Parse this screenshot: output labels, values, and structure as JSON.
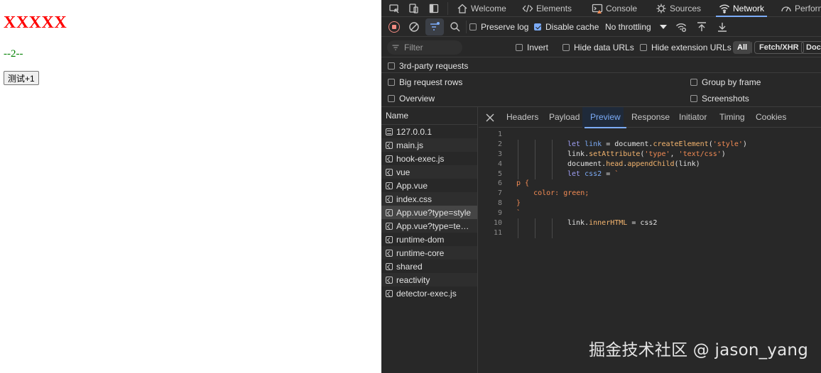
{
  "webpage": {
    "heading": "XXXXX",
    "counter": "--2--",
    "button_label": "测试+1",
    "heading_color": "#ff0000",
    "counter_color": "#008000"
  },
  "devtools": {
    "tabs": [
      {
        "label": "Welcome",
        "icon": "home-icon"
      },
      {
        "label": "Elements",
        "icon": "code-brackets-icon"
      },
      {
        "label": "Console",
        "icon": "console-warning-icon"
      },
      {
        "label": "Sources",
        "icon": "sources-icon"
      },
      {
        "label": "Network",
        "icon": "wifi-icon",
        "active": true
      },
      {
        "label": "Perform",
        "icon": "performance-icon"
      }
    ],
    "toolbar": {
      "preserve_log": "Preserve log",
      "preserve_log_checked": false,
      "disable_cache": "Disable cache",
      "disable_cache_checked": true,
      "throttling": "No throttling"
    },
    "filter": {
      "placeholder": "Filter",
      "invert": "Invert",
      "hide_data_urls": "Hide data URLs",
      "hide_extension_urls": "Hide extension URLs",
      "type_all": "All",
      "type_fetch": "Fetch/XHR",
      "type_doc": "Doc"
    },
    "third_party": "3rd-party requests",
    "settings": {
      "big_request_rows": "Big request rows",
      "overview": "Overview",
      "group_by_frame": "Group by frame",
      "screenshots": "Screenshots"
    },
    "request_list": {
      "header": "Name",
      "items": [
        {
          "name": "127.0.0.1",
          "type": "doc"
        },
        {
          "name": "main.js",
          "type": "code"
        },
        {
          "name": "hook-exec.js",
          "type": "code"
        },
        {
          "name": "vue",
          "type": "code"
        },
        {
          "name": "App.vue",
          "type": "code"
        },
        {
          "name": "index.css",
          "type": "code"
        },
        {
          "name": "App.vue?type=style",
          "type": "code",
          "selected": true
        },
        {
          "name": "App.vue?type=tem...",
          "type": "code"
        },
        {
          "name": "runtime-dom",
          "type": "code"
        },
        {
          "name": "runtime-core",
          "type": "code"
        },
        {
          "name": "shared",
          "type": "code"
        },
        {
          "name": "reactivity",
          "type": "code"
        },
        {
          "name": "detector-exec.js",
          "type": "code"
        }
      ]
    },
    "detail_tabs": [
      "Headers",
      "Payload",
      "Preview",
      "Response",
      "Initiator",
      "Timing",
      "Cookies"
    ],
    "detail_active": "Preview",
    "code_lines": [
      {
        "n": "1",
        "indent": 0,
        "tokens": []
      },
      {
        "n": "2",
        "indent": 3,
        "tokens": [
          [
            "kw",
            "let "
          ],
          [
            "def",
            "link"
          ],
          [
            "plain",
            " = document."
          ],
          [
            "fn",
            "createElement"
          ],
          [
            "plain",
            "("
          ],
          [
            "str",
            "'style'"
          ],
          [
            "plain",
            ")"
          ]
        ]
      },
      {
        "n": "3",
        "indent": 3,
        "tokens": [
          [
            "plain",
            "link."
          ],
          [
            "fn",
            "setAttribute"
          ],
          [
            "plain",
            "("
          ],
          [
            "str",
            "'type'"
          ],
          [
            "plain",
            ", "
          ],
          [
            "str",
            "'text/css'"
          ],
          [
            "plain",
            ")"
          ]
        ]
      },
      {
        "n": "4",
        "indent": 3,
        "tokens": [
          [
            "plain",
            "document."
          ],
          [
            "fn",
            "head"
          ],
          [
            "plain",
            "."
          ],
          [
            "fn",
            "appendChild"
          ],
          [
            "plain",
            "(link)"
          ]
        ]
      },
      {
        "n": "5",
        "indent": 3,
        "tokens": [
          [
            "kw",
            "let "
          ],
          [
            "def",
            "css2"
          ],
          [
            "plain",
            " = "
          ],
          [
            "str",
            "`"
          ]
        ]
      },
      {
        "n": "6",
        "indent": 0,
        "tokens": [
          [
            "sel",
            "p {"
          ]
        ]
      },
      {
        "n": "7",
        "indent": 0,
        "tokens": [
          [
            "sel",
            "    color: green;"
          ]
        ]
      },
      {
        "n": "8",
        "indent": 0,
        "tokens": [
          [
            "sel",
            "}"
          ]
        ]
      },
      {
        "n": "9",
        "indent": 0,
        "tokens": [
          [
            "str",
            "`"
          ]
        ]
      },
      {
        "n": "10",
        "indent": 3,
        "tokens": [
          [
            "plain",
            "link."
          ],
          [
            "fn",
            "innerHTML"
          ],
          [
            "plain",
            " = css2"
          ]
        ]
      },
      {
        "n": "11",
        "indent": 3,
        "tokens": []
      }
    ]
  },
  "watermark": "掘金技术社区 @ jason_yang"
}
